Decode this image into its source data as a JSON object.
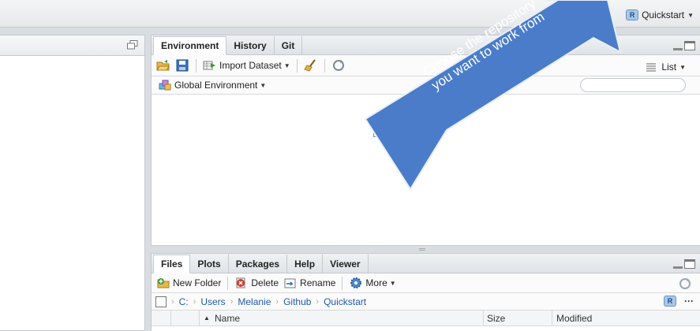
{
  "topbar": {
    "project_label": "Quickstart"
  },
  "env_pane": {
    "tabs": [
      "Environment",
      "History",
      "Git"
    ],
    "import_label": "Import Dataset",
    "list_label": "List",
    "env_scope": "Global Environment",
    "empty_text": "Envi"
  },
  "files_pane": {
    "tabs": [
      "Files",
      "Plots",
      "Packages",
      "Help",
      "Viewer"
    ],
    "new_folder": "New Folder",
    "delete": "Delete",
    "rename": "Rename",
    "more": "More",
    "path": [
      "C:",
      "Users",
      "Melanie",
      "Github",
      "Quickstart"
    ],
    "columns": {
      "name": "Name",
      "size": "Size",
      "modified": "Modified"
    },
    "overflow": "···"
  },
  "callout": {
    "line1": "Choose the repository",
    "line2": "you want to work from",
    "color": "#4a7cc9"
  }
}
